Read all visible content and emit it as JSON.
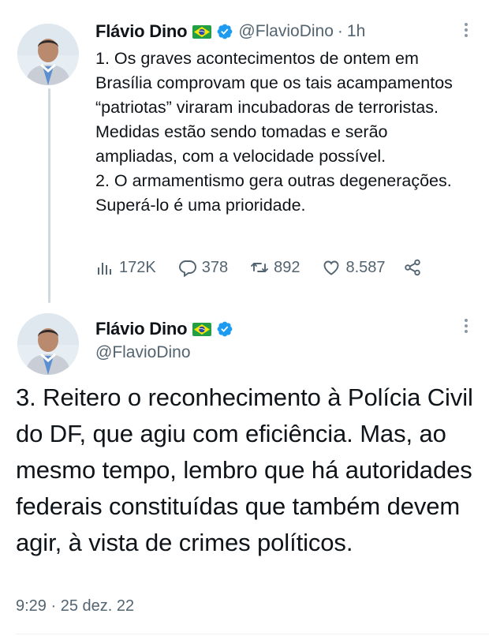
{
  "tweet1": {
    "author_name": "Flávio Dino",
    "author_flag": "brazil-flag",
    "handle": "@FlavioDino",
    "separator": "·",
    "time": "1h",
    "text": "1. Os graves acontecimentos de ontem em Brasília comprovam que os tais acampamentos “patriotas” viraram incubadoras de terroristas. Medidas estão sendo tomadas e serão ampliadas, com a velocidade possível.\n2. O armamentismo gera outras degenerações. Superá-lo é uma prioridade.",
    "stats": {
      "views": "172K",
      "replies": "378",
      "retweets": "892",
      "likes": "8.587"
    }
  },
  "tweet2": {
    "author_name": "Flávio Dino",
    "author_flag": "brazil-flag",
    "handle": "@FlavioDino",
    "text": "3. Reitero o reconhecimento à Polícia Civil do DF, que agiu com eficiência. Mas, ao mesmo tempo, lembro que há autoridades federais constituídas que também devem agir, à vista de crimes políticos.",
    "timestamp": "9:29 · 25 dez. 22"
  },
  "colors": {
    "verified": "#1d9bf0",
    "secondary_text": "#536471",
    "thread_line": "#cfd9de"
  },
  "icons": [
    "views-icon",
    "reply-icon",
    "retweet-icon",
    "like-icon",
    "share-icon",
    "more-icon",
    "verified-icon",
    "brazil-flag-icon"
  ]
}
